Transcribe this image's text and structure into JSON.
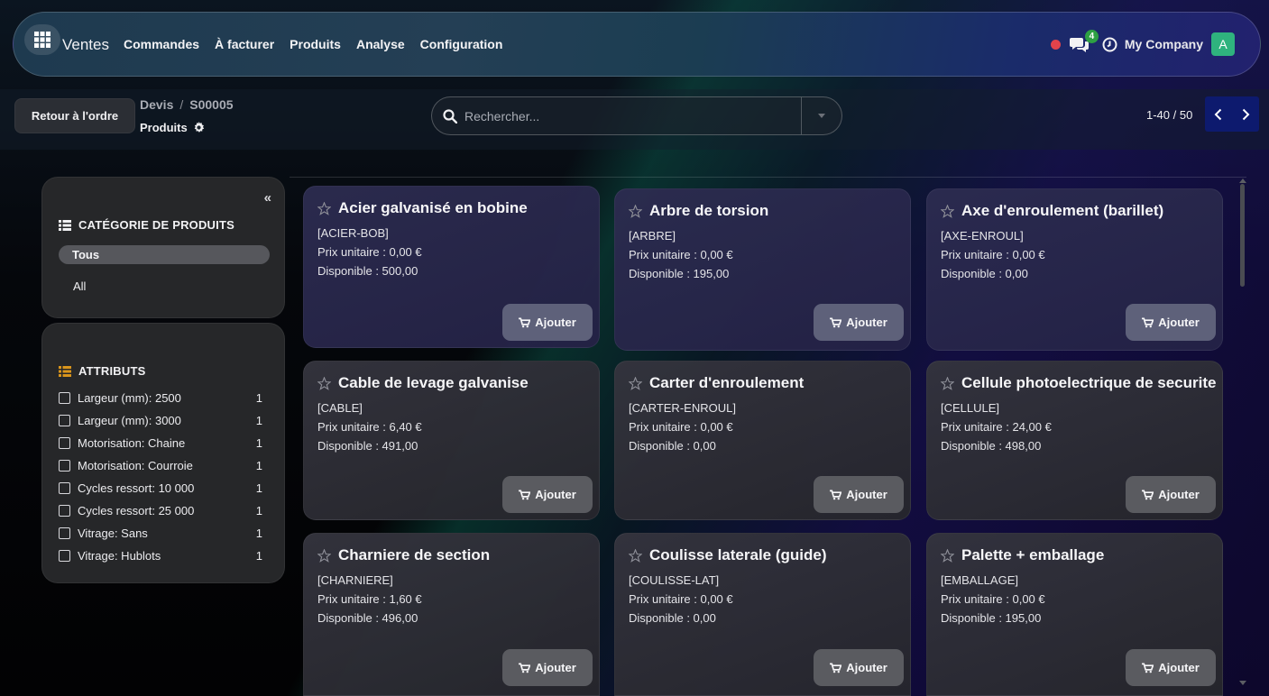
{
  "navbar": {
    "app_name": "Ventes",
    "menu": [
      "Commandes",
      "À facturer",
      "Produits",
      "Analyse",
      "Configuration"
    ],
    "chat_count": "4",
    "company": "My Company",
    "avatar_letter": "A",
    "status_color": "#e2434b",
    "avatar_color": "#2fb37e"
  },
  "control": {
    "back_label": "Retour à l'ordre",
    "breadcrumb": [
      "Devis",
      "S00005"
    ],
    "subtitle": "Produits",
    "search_placeholder": "Rechercher...",
    "pager": "1-40 / 50"
  },
  "sidebar": {
    "categories_title": "CATÉGORIE DE PRODUITS",
    "categories": [
      "Tous",
      "All"
    ],
    "attributes_title": "ATTRIBUTS",
    "attributes": [
      {
        "label": "Largeur (mm): 2500",
        "count": "1"
      },
      {
        "label": "Largeur (mm): 3000",
        "count": "1"
      },
      {
        "label": "Motorisation: Chaine",
        "count": "1"
      },
      {
        "label": "Motorisation: Courroie",
        "count": "1"
      },
      {
        "label": "Cycles ressort: 10 000",
        "count": "1"
      },
      {
        "label": "Cycles ressort: 25 000",
        "count": "1"
      },
      {
        "label": "Vitrage: Sans",
        "count": "1"
      },
      {
        "label": "Vitrage: Hublots",
        "count": "1"
      }
    ]
  },
  "products": [
    {
      "name": "Acier galvanisé en bobine",
      "ref": "[ACIER-BOB]",
      "price": "Prix unitaire : 0,00 €",
      "stock": "Disponible : 500,00",
      "button": "Ajouter"
    },
    {
      "name": "Arbre de torsion",
      "ref": "[ARBRE]",
      "price": "Prix unitaire : 0,00 €",
      "stock": "Disponible : 195,00",
      "button": "Ajouter"
    },
    {
      "name": "Axe d'enroulement (barillet)",
      "ref": "[AXE-ENROUL]",
      "price": "Prix unitaire : 0,00 €",
      "stock": "Disponible : 0,00",
      "button": "Ajouter"
    },
    {
      "name": "Cable de levage galvanise",
      "ref": "[CABLE]",
      "price": "Prix unitaire : 6,40 €",
      "stock": "Disponible : 491,00",
      "button": "Ajouter"
    },
    {
      "name": "Carter d'enroulement",
      "ref": "[CARTER-ENROUL]",
      "price": "Prix unitaire : 0,00 €",
      "stock": "Disponible : 0,00",
      "button": "Ajouter"
    },
    {
      "name": "Cellule photoelectrique de securite",
      "ref": "[CELLULE]",
      "price": "Prix unitaire : 24,00 €",
      "stock": "Disponible : 498,00",
      "button": "Ajouter"
    },
    {
      "name": "Charniere de section",
      "ref": "[CHARNIERE]",
      "price": "Prix unitaire : 1,60 €",
      "stock": "Disponible : 496,00",
      "button": "Ajouter"
    },
    {
      "name": "Coulisse laterale (guide)",
      "ref": "[COULISSE-LAT]",
      "price": "Prix unitaire : 0,00 €",
      "stock": "Disponible : 0,00",
      "button": "Ajouter"
    },
    {
      "name": "Palette + emballage",
      "ref": "[EMBALLAGE]",
      "price": "Prix unitaire : 0,00 €",
      "stock": "Disponible : 195,00",
      "button": "Ajouter"
    }
  ]
}
